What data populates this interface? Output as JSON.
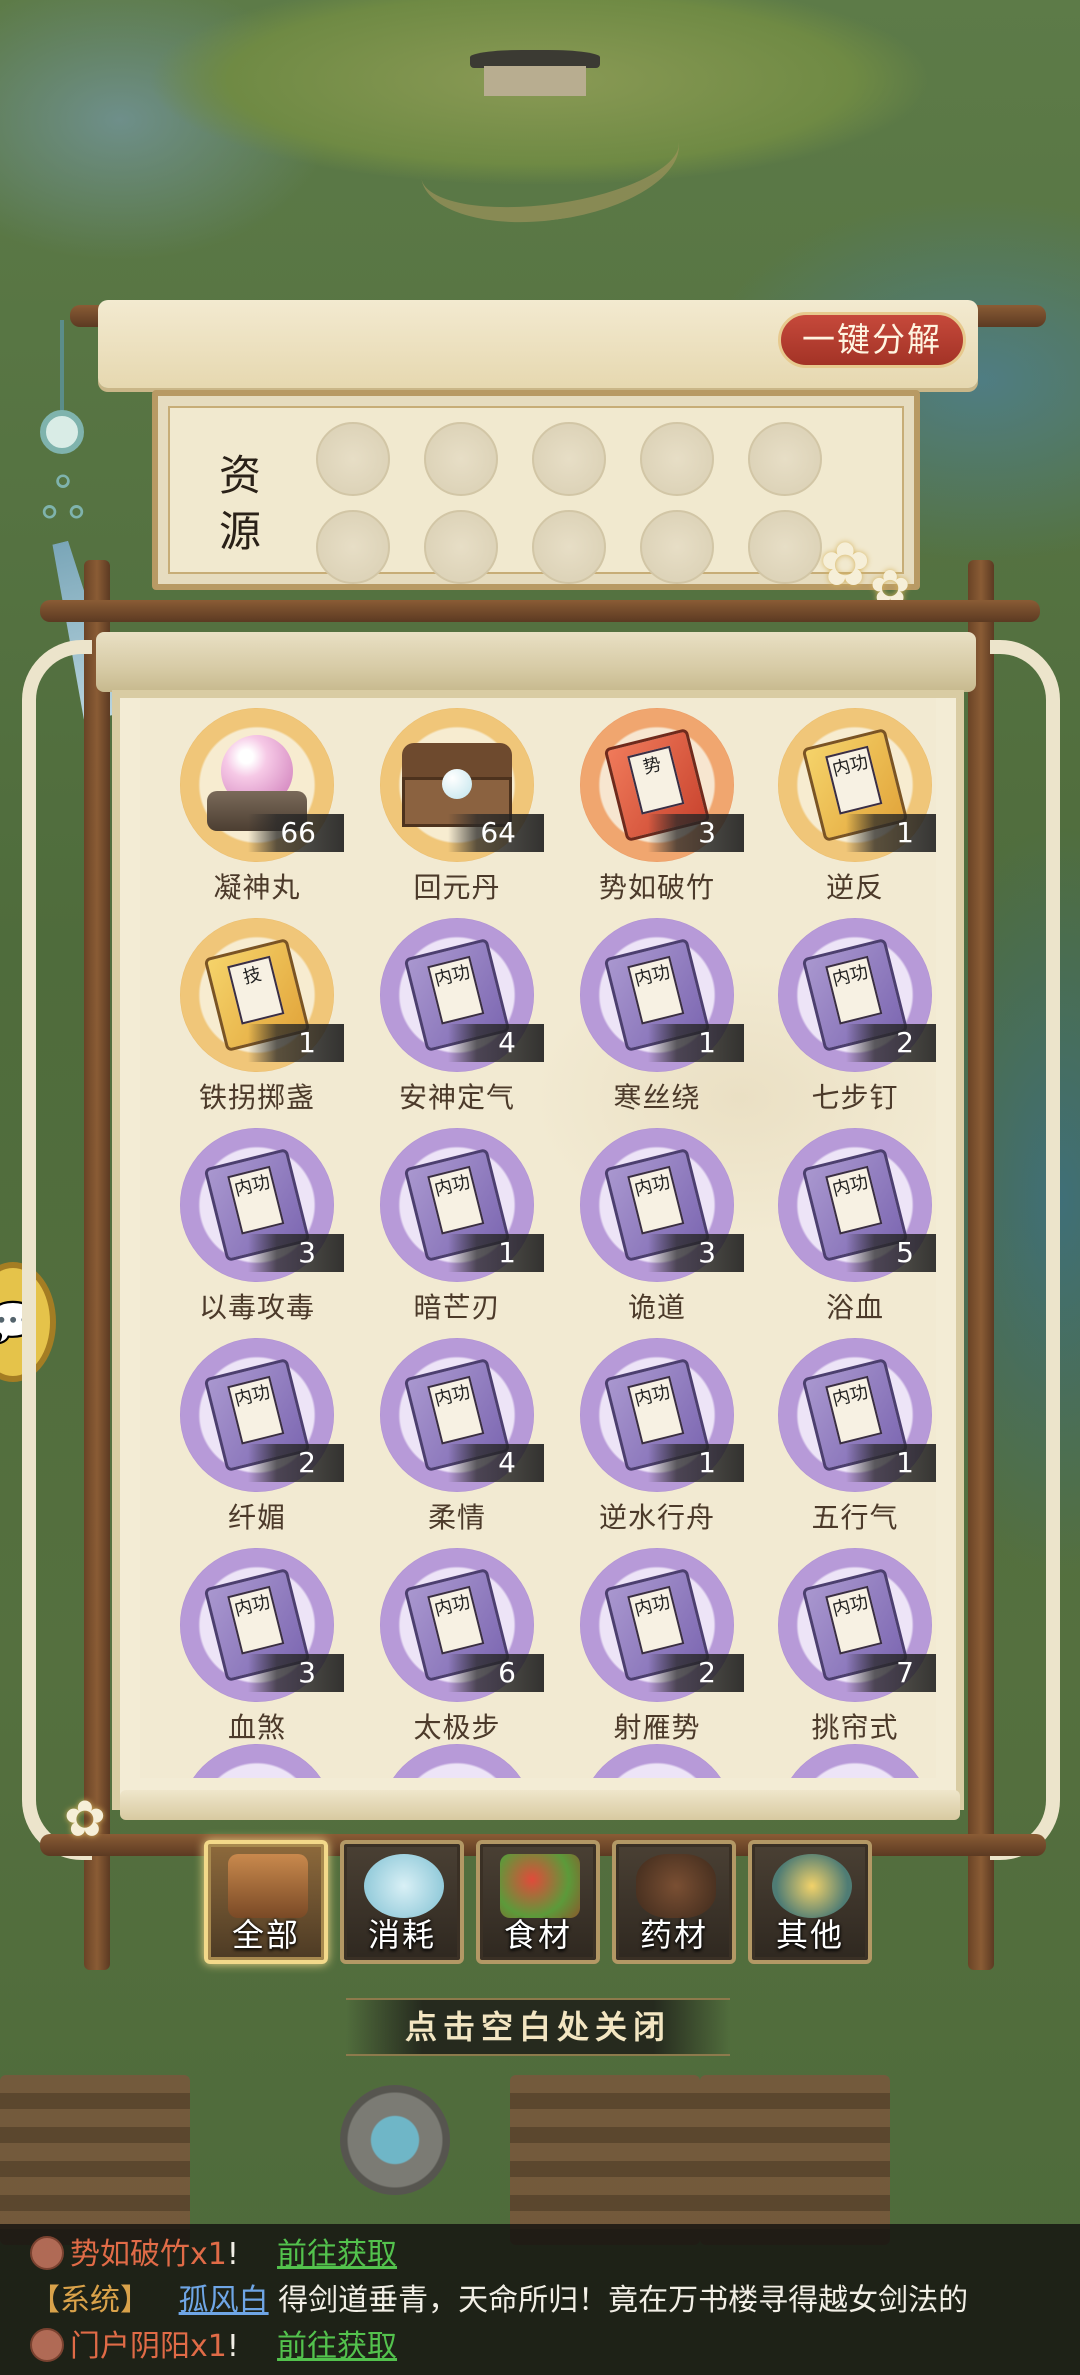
{
  "header": {
    "decompose_button": "一键分解",
    "resource_label_1": "资",
    "resource_label_2": "源"
  },
  "items": [
    {
      "name": "凝神丸",
      "count": "66",
      "icon": "pink-orb-icon",
      "ring": "gold"
    },
    {
      "name": "回元丹",
      "count": "64",
      "icon": "treasure-box-pearl-icon",
      "ring": "gold"
    },
    {
      "name": "势如破竹",
      "count": "3",
      "icon": "red-manual-icon",
      "ring": "orange"
    },
    {
      "name": "逆反",
      "count": "1",
      "icon": "yellow-manual-icon",
      "ring": "gold"
    },
    {
      "name": "铁拐掷盏",
      "count": "1",
      "icon": "yellow-manual-icon",
      "ring": "gold"
    },
    {
      "name": "安神定气",
      "count": "4",
      "icon": "purple-manual-icon",
      "ring": "purple"
    },
    {
      "name": "寒丝绕",
      "count": "1",
      "icon": "purple-manual-icon",
      "ring": "purple"
    },
    {
      "name": "七步钉",
      "count": "2",
      "icon": "purple-manual-icon",
      "ring": "purple"
    },
    {
      "name": "以毒攻毒",
      "count": "3",
      "icon": "purple-manual-icon",
      "ring": "purple"
    },
    {
      "name": "暗芒刃",
      "count": "1",
      "icon": "purple-manual-icon",
      "ring": "purple"
    },
    {
      "name": "诡道",
      "count": "3",
      "icon": "purple-manual-icon",
      "ring": "purple"
    },
    {
      "name": "浴血",
      "count": "5",
      "icon": "purple-manual-icon",
      "ring": "purple"
    },
    {
      "name": "纤媚",
      "count": "2",
      "icon": "purple-manual-icon",
      "ring": "purple"
    },
    {
      "name": "柔情",
      "count": "4",
      "icon": "purple-manual-icon",
      "ring": "purple"
    },
    {
      "name": "逆水行舟",
      "count": "1",
      "icon": "purple-manual-icon",
      "ring": "purple"
    },
    {
      "name": "五行气",
      "count": "1",
      "icon": "purple-manual-icon",
      "ring": "purple"
    },
    {
      "name": "血煞",
      "count": "3",
      "icon": "purple-manual-icon",
      "ring": "purple"
    },
    {
      "name": "太极步",
      "count": "6",
      "icon": "purple-manual-icon",
      "ring": "purple"
    },
    {
      "name": "射雁势",
      "count": "2",
      "icon": "purple-manual-icon",
      "ring": "purple"
    },
    {
      "name": "挑帘式",
      "count": "7",
      "icon": "purple-manual-icon",
      "ring": "purple"
    }
  ],
  "manual_stamps": {
    "purple": "内功",
    "yellow_1": "内功",
    "yellow_2": "技",
    "red": "势"
  },
  "tabs": [
    {
      "label": "全部",
      "icon": "treasure-chest-icon",
      "active": true
    },
    {
      "label": "消耗",
      "icon": "potion-bottle-icon",
      "active": false
    },
    {
      "label": "食材",
      "icon": "vegetable-basket-icon",
      "active": false
    },
    {
      "label": "药材",
      "icon": "herb-pot-icon",
      "active": false
    },
    {
      "label": "其他",
      "icon": "gold-ingot-icon",
      "active": false
    }
  ],
  "close_hint": "点击空白处关闭",
  "chat": [
    {
      "item": "势如破竹x1",
      "sep": "!",
      "link": "前往获取"
    },
    {
      "tag": "【系统】",
      "user": "孤风白",
      "text": "得剑道垂青，天命所归！竟在万书楼寻得越女剑法的"
    },
    {
      "item": "门户阴阳x1",
      "sep": "!",
      "link": "前往获取"
    }
  ],
  "colors": {
    "decompose_bg": "#b83a2d",
    "purple_ring": "#8e63c1",
    "gold_ring": "#d99a3a",
    "paper": "#f2ead2",
    "link_green": "#53c24d",
    "system_tag": "#d9a24a"
  }
}
